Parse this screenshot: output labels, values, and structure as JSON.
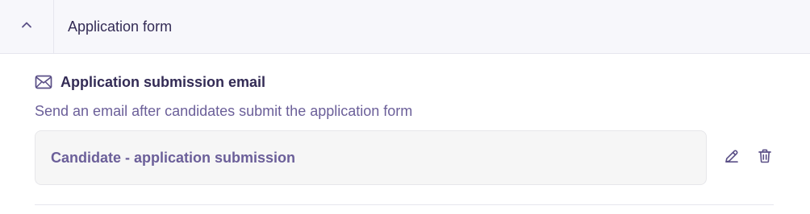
{
  "section": {
    "title": "Application form",
    "collapse_icon": "chevron-up-icon"
  },
  "email": {
    "icon": "mail-icon",
    "title": "Application submission email",
    "description": "Send an email after candidates submit the application form",
    "template_name": "Candidate - application submission"
  },
  "actions": {
    "edit_icon": "pencil-icon",
    "delete_icon": "trash-icon"
  },
  "colors": {
    "title": "#332b55",
    "muted": "#6b5f99",
    "icon": "#5a4f86",
    "header_bg": "#f7f7fb",
    "template_bg": "#f6f6f6"
  }
}
